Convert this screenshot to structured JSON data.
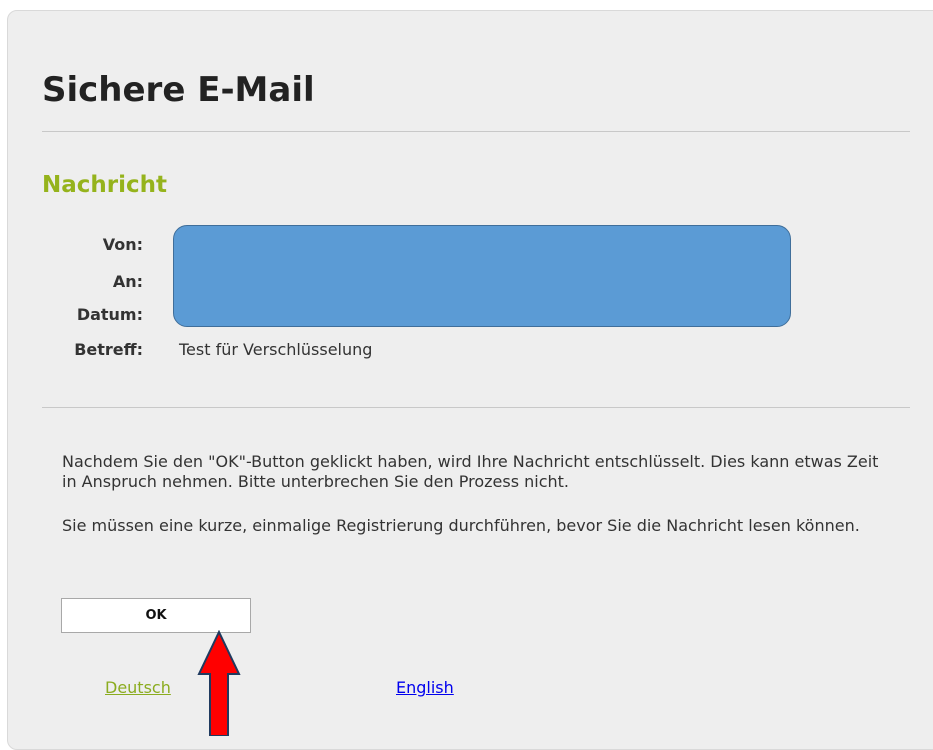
{
  "page": {
    "title": "Sichere E-Mail"
  },
  "message": {
    "section_title": "Nachricht",
    "labels": {
      "from": "Von:",
      "to": "An:",
      "date": "Datum:",
      "subject": "Betreff:"
    },
    "subject_value": "Test für Verschlüsselung"
  },
  "info": {
    "paragraph_1": "Nachdem Sie den \"OK\"-Button geklickt haben, wird Ihre Nachricht entschlüsselt. Dies kann etwas Zeit in Anspruch nehmen. Bitte unterbrechen Sie den Prozess nicht.",
    "paragraph_2": "Sie müssen eine kurze, einmalige Registrierung durchführen, bevor Sie die Nachricht lesen können."
  },
  "actions": {
    "ok_label": "OK"
  },
  "languages": {
    "german": "Deutsch",
    "english": "English"
  },
  "colors": {
    "section_title": "#95b31c",
    "redaction_box": "#5b9bd5",
    "annotation_arrow": "#ff0000",
    "link_english": "#0000ee",
    "link_deutsch": "#8bac1f"
  },
  "icons": {
    "annotation_arrow": "up-arrow-icon"
  }
}
